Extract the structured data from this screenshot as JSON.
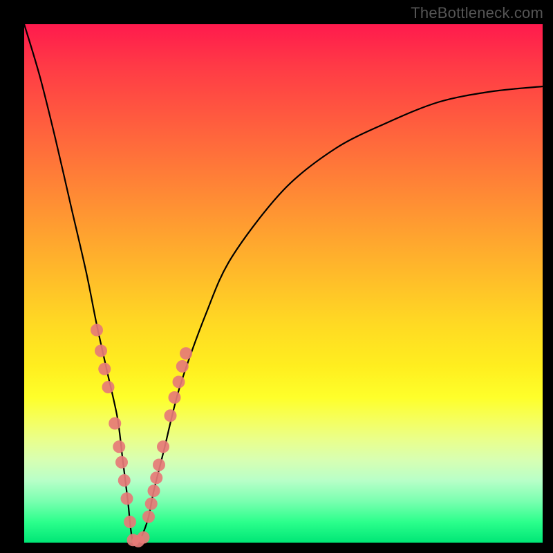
{
  "attribution": "TheBottleneck.com",
  "chart_data": {
    "type": "line",
    "title": "",
    "xlabel": "",
    "ylabel": "",
    "ylim": [
      0,
      100
    ],
    "xlim": [
      0,
      100
    ],
    "series": [
      {
        "name": "bottleneck-curve",
        "x_pct": [
          0,
          3,
          6,
          9,
          12,
          14,
          16,
          18,
          19,
          20,
          20.5,
          21,
          21.5,
          22,
          23,
          24,
          25,
          27,
          30,
          35,
          40,
          50,
          60,
          70,
          80,
          90,
          100
        ],
        "y_pct": [
          100,
          90,
          78,
          65,
          52,
          42,
          33,
          24,
          16,
          8,
          3,
          0,
          0,
          0,
          2,
          5,
          10,
          18,
          30,
          44,
          55,
          68,
          76,
          81,
          85,
          87,
          88
        ]
      }
    ],
    "marker_clusters": [
      {
        "name": "left-branch-markers",
        "points": [
          {
            "x_pct": 14.0,
            "y_pct": 41.0
          },
          {
            "x_pct": 14.8,
            "y_pct": 37.0
          },
          {
            "x_pct": 15.5,
            "y_pct": 33.5
          },
          {
            "x_pct": 16.2,
            "y_pct": 30.0
          },
          {
            "x_pct": 17.5,
            "y_pct": 23.0
          },
          {
            "x_pct": 18.3,
            "y_pct": 18.5
          },
          {
            "x_pct": 18.8,
            "y_pct": 15.5
          },
          {
            "x_pct": 19.3,
            "y_pct": 12.0
          },
          {
            "x_pct": 19.8,
            "y_pct": 8.5
          },
          {
            "x_pct": 20.4,
            "y_pct": 4.0
          }
        ]
      },
      {
        "name": "bottom-markers",
        "points": [
          {
            "x_pct": 21.0,
            "y_pct": 0.5
          },
          {
            "x_pct": 22.0,
            "y_pct": 0.3
          },
          {
            "x_pct": 23.0,
            "y_pct": 1.0
          }
        ]
      },
      {
        "name": "right-branch-markers",
        "points": [
          {
            "x_pct": 24.0,
            "y_pct": 5.0
          },
          {
            "x_pct": 24.5,
            "y_pct": 7.5
          },
          {
            "x_pct": 25.0,
            "y_pct": 10.0
          },
          {
            "x_pct": 25.5,
            "y_pct": 12.5
          },
          {
            "x_pct": 26.0,
            "y_pct": 15.0
          },
          {
            "x_pct": 26.8,
            "y_pct": 18.5
          },
          {
            "x_pct": 28.2,
            "y_pct": 24.5
          },
          {
            "x_pct": 29.0,
            "y_pct": 28.0
          },
          {
            "x_pct": 29.8,
            "y_pct": 31.0
          },
          {
            "x_pct": 30.5,
            "y_pct": 34.0
          },
          {
            "x_pct": 31.2,
            "y_pct": 36.5
          }
        ]
      }
    ],
    "colors": {
      "curve": "#000000",
      "markers": "#e67a77"
    }
  }
}
